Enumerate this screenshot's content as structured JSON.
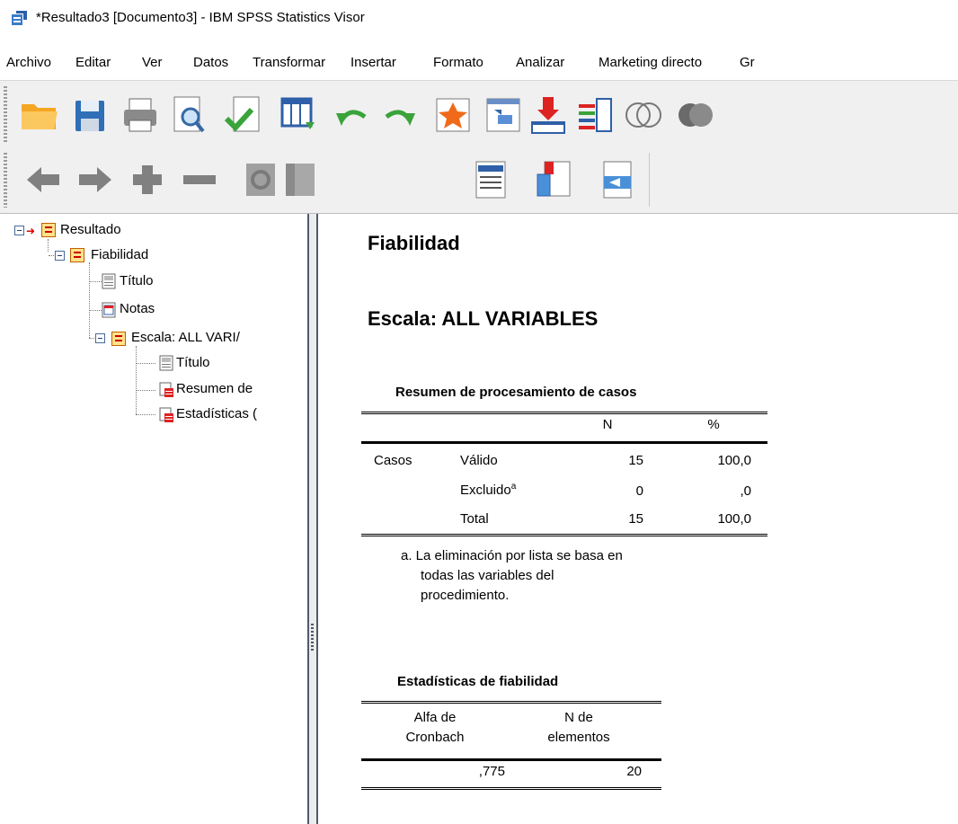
{
  "window": {
    "title": "*Resultado3 [Documento3] - IBM SPSS Statistics Visor"
  },
  "menu": [
    {
      "label": "Archivo"
    },
    {
      "label": "Editar"
    },
    {
      "label": "Ver"
    },
    {
      "label": "Datos"
    },
    {
      "label": "Transformar"
    },
    {
      "label": "Insertar"
    },
    {
      "label": "Formato"
    },
    {
      "label": "Analizar"
    },
    {
      "label": "Marketing directo"
    },
    {
      "label": "Gr"
    }
  ],
  "toolbar1": [
    "open-icon",
    "save-icon",
    "print-icon",
    "print-preview-icon",
    "export-icon",
    "goto-data-icon",
    "undo-icon",
    "redo-icon",
    "goto-case-icon",
    "goto-variable-icon",
    "insert-cases-icon",
    "variables-icon",
    "venn-icon",
    "venn-dark-icon"
  ],
  "toolbar2": [
    "back-icon",
    "forward-icon",
    "expand-icon",
    "collapse-icon",
    "show-icon",
    "hide-icon",
    "insert-heading-icon",
    "insert-title-icon",
    "insert-text-icon"
  ],
  "outline": {
    "root": "Resultado",
    "section": "Fiabilidad",
    "title1": "Título",
    "notes": "Notas",
    "scale": "Escala: ALL VARI/",
    "title2": "Título",
    "summary": "Resumen de",
    "stats": "Estadísticas ("
  },
  "output": {
    "heading": "Fiabilidad",
    "subheading": "Escala: ALL VARIABLES",
    "table1": {
      "title": "Resumen de procesamiento de casos",
      "col_n": "N",
      "col_pct": "%",
      "row_group": "Casos",
      "rows": [
        {
          "label": "Válido",
          "sup": "",
          "n": "15",
          "pct": "100,0"
        },
        {
          "label": "Excluido",
          "sup": "a",
          "n": "0",
          "pct": ",0"
        },
        {
          "label": "Total",
          "sup": "",
          "n": "15",
          "pct": "100,0"
        }
      ],
      "footnote_l1": "a. La eliminación por lista se basa en",
      "footnote_l2": "todas las variables del",
      "footnote_l3": "procedimiento."
    },
    "table2": {
      "title": "Estadísticas de fiabilidad",
      "col1_l1": "Alfa de",
      "col1_l2": "Cronbach",
      "col2_l1": "N de",
      "col2_l2": "elementos",
      "alpha": ",775",
      "n_items": "20"
    }
  }
}
